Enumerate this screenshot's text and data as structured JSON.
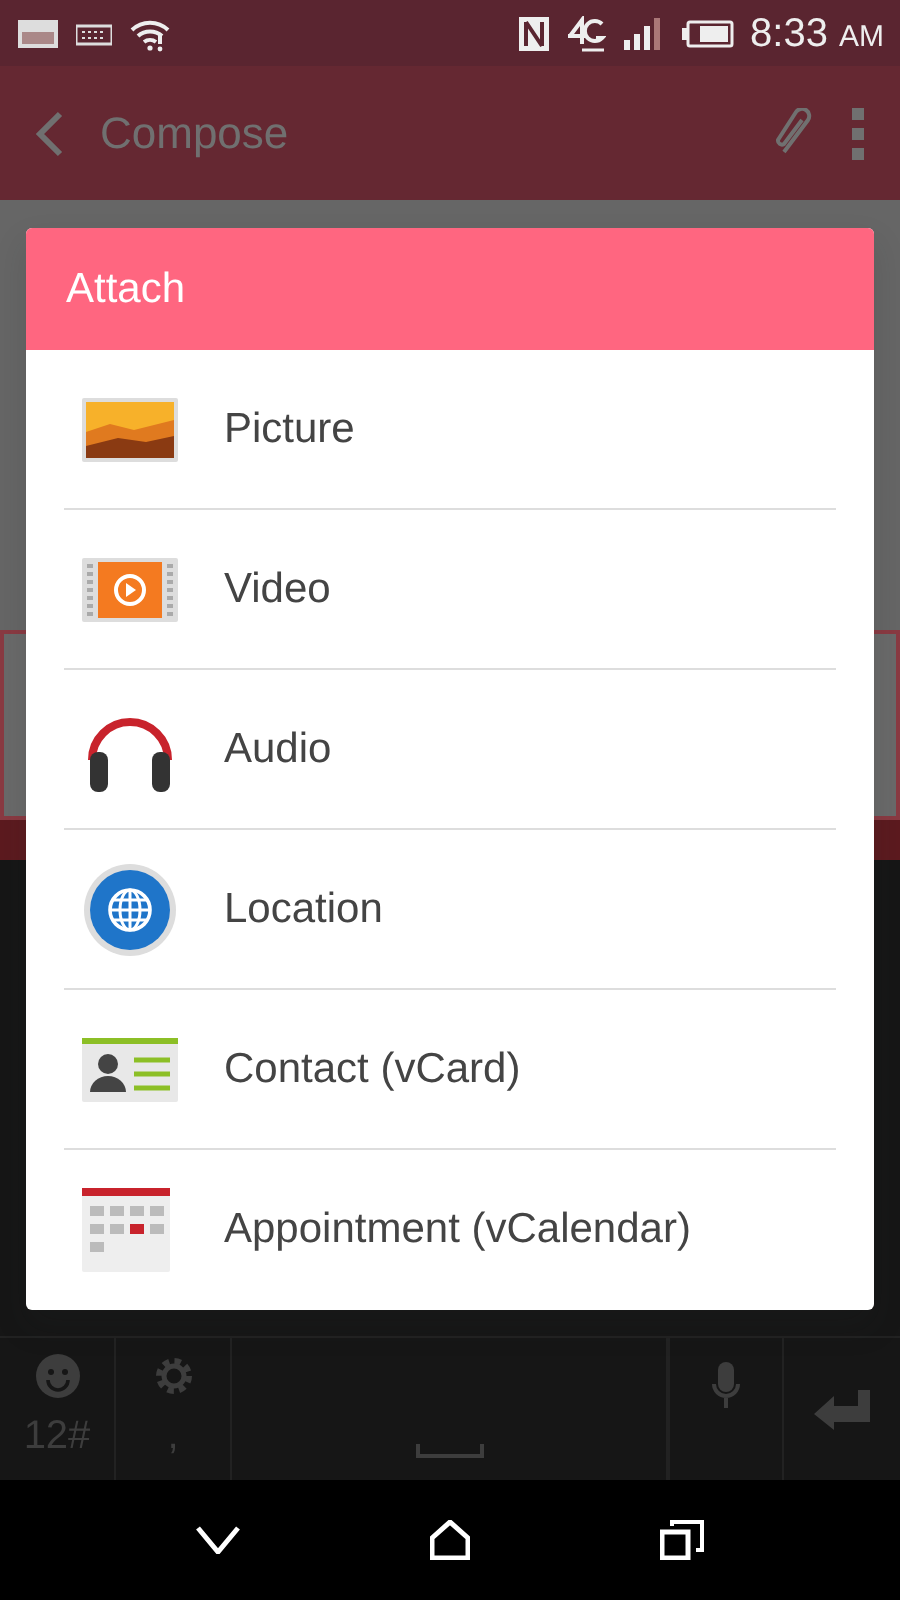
{
  "status_bar": {
    "time": "8:33",
    "time_suffix": "AM"
  },
  "app_bar": {
    "title": "Compose"
  },
  "dialog": {
    "title": "Attach",
    "items": [
      {
        "label": "Picture",
        "kind": "picture"
      },
      {
        "label": "Video",
        "kind": "video"
      },
      {
        "label": "Audio",
        "kind": "audio"
      },
      {
        "label": "Location",
        "kind": "location"
      },
      {
        "label": "Contact (vCard)",
        "kind": "contact"
      },
      {
        "label": "Appointment (vCalendar)",
        "kind": "calendar"
      }
    ]
  },
  "keyboard": {
    "keys": [
      {
        "label": "12#",
        "kind": "emoji"
      },
      {
        "label": ",",
        "kind": "settings"
      }
    ]
  }
}
